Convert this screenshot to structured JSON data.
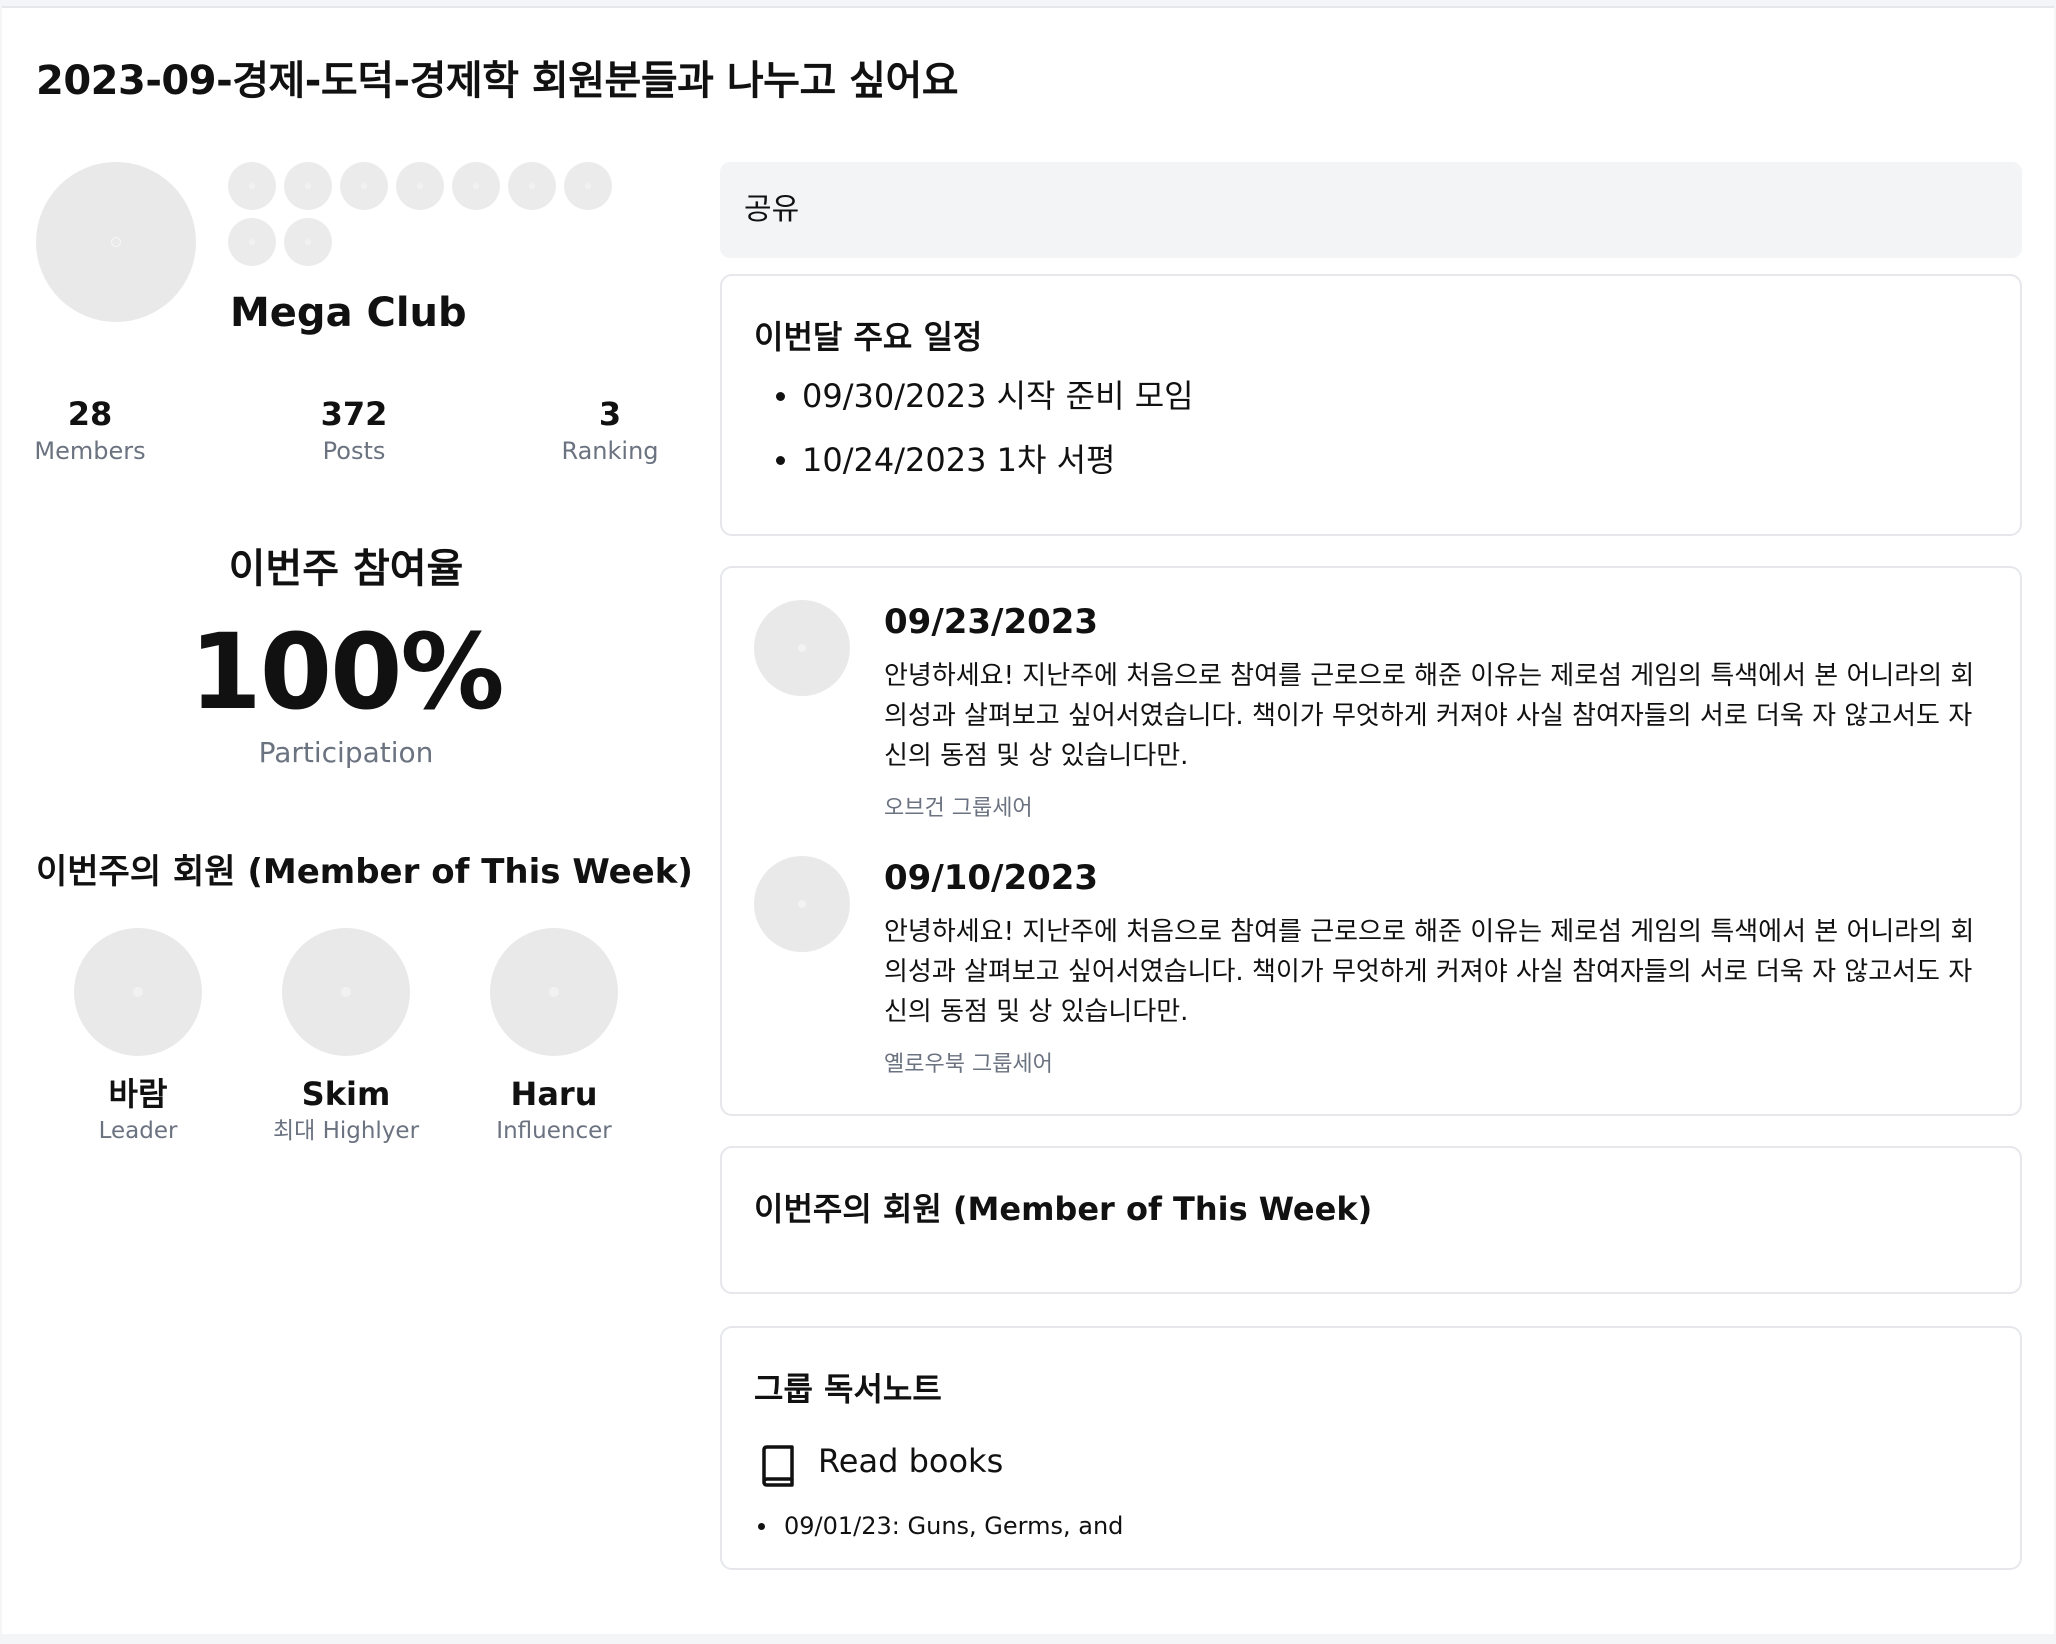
{
  "page": {
    "title": "2023-09-경제-도덕-경제학 회원분들과 나누고 싶어요"
  },
  "club": {
    "name": "Mega Club",
    "stats": [
      {
        "value": "28",
        "label": "Members"
      },
      {
        "value": "372",
        "label": "Posts"
      },
      {
        "value": "3",
        "label": "Ranking"
      }
    ]
  },
  "participation": {
    "title": "이번주 참여율",
    "value": "100%",
    "label": "Participation"
  },
  "member_of_week_left": {
    "title": "이번주의 회원 (Member of This Week)",
    "members": [
      {
        "name": "바람",
        "role": "Leader"
      },
      {
        "name": "Skim",
        "role": "최대 Highlyer"
      },
      {
        "name": "Haru",
        "role": "Influencer"
      }
    ]
  },
  "share": {
    "label": "공유"
  },
  "schedule": {
    "title": "이번달 주요 일정",
    "items": [
      "09/30/2023 시작 준비 모임",
      "10/24/2023 1차 서평"
    ]
  },
  "posts": [
    {
      "date": "09/23/2023",
      "body": "안녕하세요! 지난주에 처음으로 참여를 근로으로 해준 이유는 제로섬 게임의 특색에서 본 어니라의 회의성과 살펴보고 싶어서였습니다. 책이가 무엇하게 커져야 사실 참여자들의 서로 더욱 자 않고서도 자신의 동점 및 상 있습니다만.",
      "meta": "오브건 그룹세어"
    },
    {
      "date": "09/10/2023",
      "body": "안녕하세요! 지난주에 처음으로 참여를 근로으로 해준 이유는 제로섬 게임의 특색에서 본 어니라의 회의성과 살펴보고 싶어서였습니다. 책이가 무엇하게 커져야 사실 참여자들의 서로 더욱 자 않고서도 자신의 동점 및 상 있습니다만.",
      "meta": "옐로우북 그룹세어"
    }
  ],
  "member_of_week_right": {
    "title": "이번주의 회원 (Member of This Week)"
  },
  "reading_notes": {
    "title": "그룹 독서노트",
    "read_books_label": "Read books",
    "books": [
      "09/01/23: Guns, Germs, and"
    ]
  }
}
